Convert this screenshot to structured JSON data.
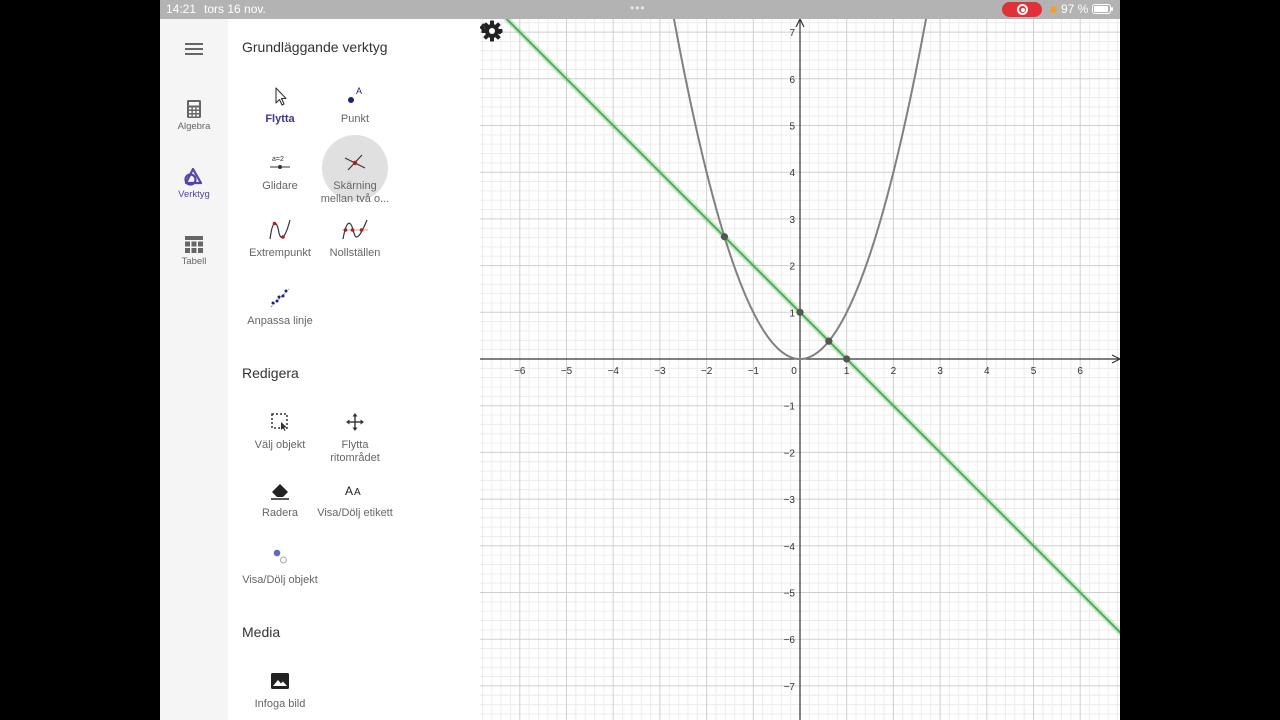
{
  "status_bar": {
    "time": "14:21",
    "date": "tors 16 nov.",
    "battery": "97 %"
  },
  "nav": {
    "items": [
      {
        "label": "Algebra",
        "icon": "calculator-icon"
      },
      {
        "label": "Verktyg",
        "icon": "tools-icon",
        "active": true
      },
      {
        "label": "Tabell",
        "icon": "table-icon"
      }
    ]
  },
  "tools_panel": {
    "sections": [
      {
        "title": "Grundläggande verktyg",
        "tools": [
          {
            "label": "Flytta",
            "icon": "move-cursor-icon",
            "selected": true
          },
          {
            "label": "Punkt",
            "icon": "point-icon"
          },
          {
            "label": "Glidare",
            "icon": "slider-icon"
          },
          {
            "label": "Skärning mellan två o...",
            "icon": "intersect-icon",
            "pressed": true
          },
          {
            "label": "Extrempunkt",
            "icon": "extremum-icon"
          },
          {
            "label": "Nollställen",
            "icon": "roots-icon"
          },
          {
            "label": "Anpassa linje",
            "icon": "fit-line-icon"
          }
        ]
      },
      {
        "title": "Redigera",
        "tools": [
          {
            "label": "Välj objekt",
            "icon": "select-icon"
          },
          {
            "label": "Flytta ritområdet",
            "icon": "move-view-icon"
          },
          {
            "label": "Radera",
            "icon": "eraser-icon"
          },
          {
            "label": "Visa/Dölj etikett",
            "icon": "label-icon"
          },
          {
            "label": "Visa/Dölj objekt",
            "icon": "show-hide-icon"
          }
        ]
      },
      {
        "title": "Media",
        "tools": [
          {
            "label": "Infoga bild",
            "icon": "image-icon"
          }
        ]
      }
    ]
  },
  "colors": {
    "accent": "#5145a8",
    "line": "#4caf50",
    "curve": "#808080",
    "points": "#555555",
    "recording": "#e0313b"
  },
  "chart_data": {
    "type": "line",
    "xlim": [
      -7,
      7
    ],
    "ylim": [
      -7.5,
      7.5
    ],
    "grid": true,
    "x_ticks": [
      "-6",
      "-5",
      "-4",
      "-3",
      "-2",
      "-1",
      "0",
      "1",
      "2",
      "3",
      "4",
      "5",
      "6"
    ],
    "y_ticks": [
      "7",
      "6",
      "5",
      "4",
      "3",
      "2",
      "1",
      "-1",
      "-2",
      "-3",
      "-4",
      "-5",
      "-6",
      "-7"
    ],
    "functions": [
      {
        "expression": "f(x) = x^2",
        "color": "#808080"
      },
      {
        "expression": "g(x) = 1 - x",
        "color": "#4caf50"
      }
    ],
    "points": [
      {
        "x": -1.618,
        "y": 2.618
      },
      {
        "x": 0.618,
        "y": 0.382
      },
      {
        "x": 0,
        "y": 1
      },
      {
        "x": 1,
        "y": 0
      }
    ]
  }
}
